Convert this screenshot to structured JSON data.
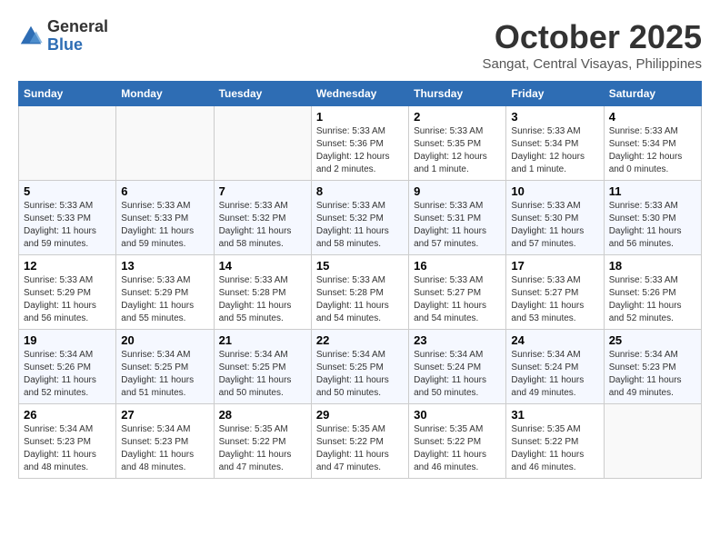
{
  "header": {
    "logo_general": "General",
    "logo_blue": "Blue",
    "month": "October 2025",
    "location": "Sangat, Central Visayas, Philippines"
  },
  "weekdays": [
    "Sunday",
    "Monday",
    "Tuesday",
    "Wednesday",
    "Thursday",
    "Friday",
    "Saturday"
  ],
  "weeks": [
    [
      {
        "day": "",
        "info": ""
      },
      {
        "day": "",
        "info": ""
      },
      {
        "day": "",
        "info": ""
      },
      {
        "day": "1",
        "info": "Sunrise: 5:33 AM\nSunset: 5:36 PM\nDaylight: 12 hours\nand 2 minutes."
      },
      {
        "day": "2",
        "info": "Sunrise: 5:33 AM\nSunset: 5:35 PM\nDaylight: 12 hours\nand 1 minute."
      },
      {
        "day": "3",
        "info": "Sunrise: 5:33 AM\nSunset: 5:34 PM\nDaylight: 12 hours\nand 1 minute."
      },
      {
        "day": "4",
        "info": "Sunrise: 5:33 AM\nSunset: 5:34 PM\nDaylight: 12 hours\nand 0 minutes."
      }
    ],
    [
      {
        "day": "5",
        "info": "Sunrise: 5:33 AM\nSunset: 5:33 PM\nDaylight: 11 hours\nand 59 minutes."
      },
      {
        "day": "6",
        "info": "Sunrise: 5:33 AM\nSunset: 5:33 PM\nDaylight: 11 hours\nand 59 minutes."
      },
      {
        "day": "7",
        "info": "Sunrise: 5:33 AM\nSunset: 5:32 PM\nDaylight: 11 hours\nand 58 minutes."
      },
      {
        "day": "8",
        "info": "Sunrise: 5:33 AM\nSunset: 5:32 PM\nDaylight: 11 hours\nand 58 minutes."
      },
      {
        "day": "9",
        "info": "Sunrise: 5:33 AM\nSunset: 5:31 PM\nDaylight: 11 hours\nand 57 minutes."
      },
      {
        "day": "10",
        "info": "Sunrise: 5:33 AM\nSunset: 5:30 PM\nDaylight: 11 hours\nand 57 minutes."
      },
      {
        "day": "11",
        "info": "Sunrise: 5:33 AM\nSunset: 5:30 PM\nDaylight: 11 hours\nand 56 minutes."
      }
    ],
    [
      {
        "day": "12",
        "info": "Sunrise: 5:33 AM\nSunset: 5:29 PM\nDaylight: 11 hours\nand 56 minutes."
      },
      {
        "day": "13",
        "info": "Sunrise: 5:33 AM\nSunset: 5:29 PM\nDaylight: 11 hours\nand 55 minutes."
      },
      {
        "day": "14",
        "info": "Sunrise: 5:33 AM\nSunset: 5:28 PM\nDaylight: 11 hours\nand 55 minutes."
      },
      {
        "day": "15",
        "info": "Sunrise: 5:33 AM\nSunset: 5:28 PM\nDaylight: 11 hours\nand 54 minutes."
      },
      {
        "day": "16",
        "info": "Sunrise: 5:33 AM\nSunset: 5:27 PM\nDaylight: 11 hours\nand 54 minutes."
      },
      {
        "day": "17",
        "info": "Sunrise: 5:33 AM\nSunset: 5:27 PM\nDaylight: 11 hours\nand 53 minutes."
      },
      {
        "day": "18",
        "info": "Sunrise: 5:33 AM\nSunset: 5:26 PM\nDaylight: 11 hours\nand 52 minutes."
      }
    ],
    [
      {
        "day": "19",
        "info": "Sunrise: 5:34 AM\nSunset: 5:26 PM\nDaylight: 11 hours\nand 52 minutes."
      },
      {
        "day": "20",
        "info": "Sunrise: 5:34 AM\nSunset: 5:25 PM\nDaylight: 11 hours\nand 51 minutes."
      },
      {
        "day": "21",
        "info": "Sunrise: 5:34 AM\nSunset: 5:25 PM\nDaylight: 11 hours\nand 50 minutes."
      },
      {
        "day": "22",
        "info": "Sunrise: 5:34 AM\nSunset: 5:25 PM\nDaylight: 11 hours\nand 50 minutes."
      },
      {
        "day": "23",
        "info": "Sunrise: 5:34 AM\nSunset: 5:24 PM\nDaylight: 11 hours\nand 50 minutes."
      },
      {
        "day": "24",
        "info": "Sunrise: 5:34 AM\nSunset: 5:24 PM\nDaylight: 11 hours\nand 49 minutes."
      },
      {
        "day": "25",
        "info": "Sunrise: 5:34 AM\nSunset: 5:23 PM\nDaylight: 11 hours\nand 49 minutes."
      }
    ],
    [
      {
        "day": "26",
        "info": "Sunrise: 5:34 AM\nSunset: 5:23 PM\nDaylight: 11 hours\nand 48 minutes."
      },
      {
        "day": "27",
        "info": "Sunrise: 5:34 AM\nSunset: 5:23 PM\nDaylight: 11 hours\nand 48 minutes."
      },
      {
        "day": "28",
        "info": "Sunrise: 5:35 AM\nSunset: 5:22 PM\nDaylight: 11 hours\nand 47 minutes."
      },
      {
        "day": "29",
        "info": "Sunrise: 5:35 AM\nSunset: 5:22 PM\nDaylight: 11 hours\nand 47 minutes."
      },
      {
        "day": "30",
        "info": "Sunrise: 5:35 AM\nSunset: 5:22 PM\nDaylight: 11 hours\nand 46 minutes."
      },
      {
        "day": "31",
        "info": "Sunrise: 5:35 AM\nSunset: 5:22 PM\nDaylight: 11 hours\nand 46 minutes."
      },
      {
        "day": "",
        "info": ""
      }
    ]
  ]
}
